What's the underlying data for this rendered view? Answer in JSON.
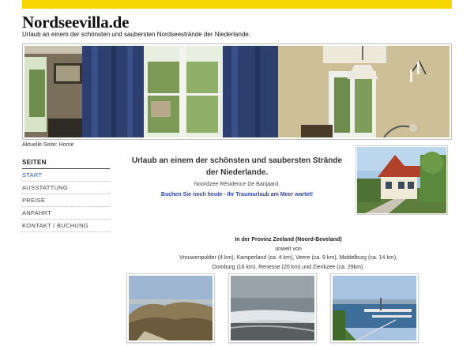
{
  "site": {
    "title": "Nordseevilla.de",
    "tagline": "Urlaub an einem der schönsten und saubersten Nordseestrände der Niederlande."
  },
  "breadcrumb": {
    "prefix": "Aktuelle Seite:",
    "current": "Home"
  },
  "sidebar": {
    "heading": "SEITEN",
    "items": [
      {
        "label": "START",
        "active": true
      },
      {
        "label": "AUSSTATTUNG"
      },
      {
        "label": "PREISE"
      },
      {
        "label": "ANFAHRT"
      },
      {
        "label": "KONTAKT / BUCHUNG"
      }
    ]
  },
  "intro": {
    "title": "Urlaub an einem der schönsten und saubersten Strände der Niederlande.",
    "subtitle": "Noordzee Résidence De Banjaard.",
    "cta": "Buchen Sie noch heute - Ihr Traumurlaub am Meer wartet!"
  },
  "location": {
    "heading": "In der Provinz Zeeland (Noord-Beveland)",
    "line1": "unweit von",
    "line2": "Vrouwenpolder (4 km), Kamperland (ca. 4 km), Veere (ca. 9 km), Middelburg (ca. 14 km),",
    "line3": "Domburg (16 km), Renesse (20 km) und Zierikzee (ca. 29km)."
  },
  "colors": {
    "accent_bar": "#f7d600",
    "link": "#2a56c6",
    "cta": "#3344aa"
  }
}
